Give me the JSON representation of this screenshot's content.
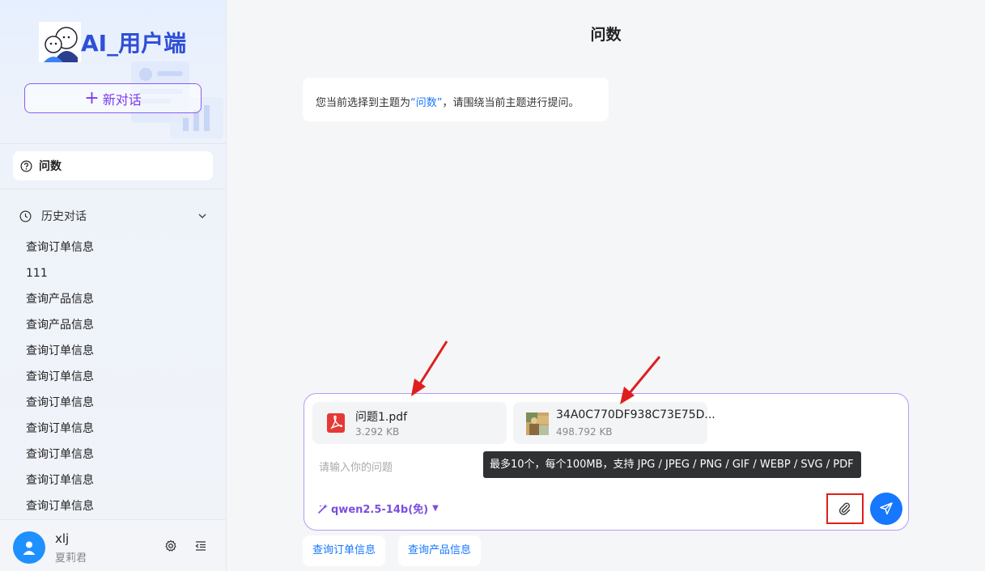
{
  "sidebar": {
    "logo_text": "AI_用户端",
    "new_chat_label": "新对话",
    "topic_label": "问数",
    "history_title": "历史对话",
    "history": [
      "查询订单信息",
      "111",
      "查询产品信息",
      "查询产品信息",
      "查询订单信息",
      "查询订单信息",
      "查询订单信息",
      "查询订单信息",
      "查询订单信息",
      "查询订单信息",
      "查询订单信息"
    ],
    "user": {
      "name": "xlj",
      "sub": "夏莉君"
    }
  },
  "main": {
    "title": "问数",
    "message_prefix": "您当前选择到主题为",
    "message_topic": "“问数”",
    "message_suffix": "，请围绕当前主题进行提问。"
  },
  "composer": {
    "files": [
      {
        "name": "问题1.pdf",
        "size": "3.292 KB",
        "kind": "pdf-icon"
      },
      {
        "name": "34A0C770DF938C73E75D...",
        "size": "498.792 KB",
        "kind": "image-thumbnail"
      }
    ],
    "placeholder": "请输入你的问题",
    "model_label": "qwen2.5-14b(免)",
    "tooltip": "最多10个，每个100MB，支持 JPG / JPEG / PNG / GIF / WEBP / SVG / PDF"
  },
  "suggestions": [
    "查询订单信息",
    "查询产品信息"
  ],
  "colors": {
    "accent": "#7c3aed",
    "primary": "#1677ff",
    "highlight": "#e01e1e"
  }
}
